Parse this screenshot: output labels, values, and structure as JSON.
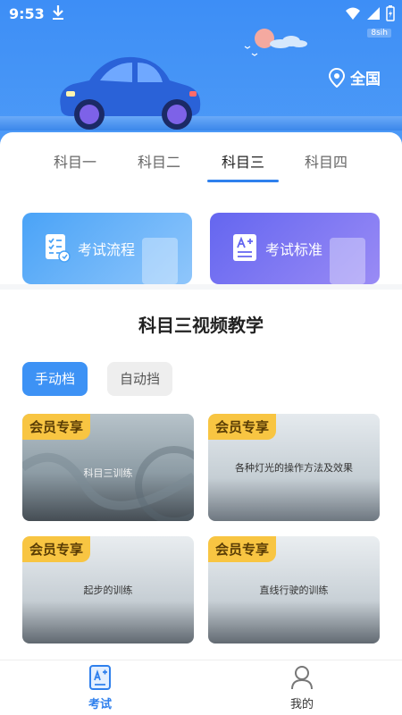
{
  "status_bar": {
    "time": "9:53",
    "speed": "8sih"
  },
  "header": {
    "location": "全国"
  },
  "tabs": [
    "科目一",
    "科目二",
    "科目三",
    "科目四"
  ],
  "active_tab": "科目三",
  "features": [
    {
      "label": "考试流程",
      "icon": "checklist-icon"
    },
    {
      "label": "考试标准",
      "icon": "document-a-plus-icon"
    }
  ],
  "section": {
    "title": "科目三视频教学"
  },
  "gear_tabs": {
    "manual": "手动档",
    "auto": "自动挡"
  },
  "videos": [
    {
      "badge": "会员专享",
      "title": "科目三训练"
    },
    {
      "badge": "会员专享",
      "title": "各种灯光的操作方法及效果"
    },
    {
      "badge": "会员专享",
      "title": "起步的训练"
    },
    {
      "badge": "会员专享",
      "title": "直线行驶的训练"
    }
  ],
  "bottom_nav": {
    "exam": "考试",
    "mine": "我的"
  },
  "colors": {
    "primary": "#3d8ef6",
    "badge": "#f8c542",
    "active_tab": "#2f80ed"
  }
}
